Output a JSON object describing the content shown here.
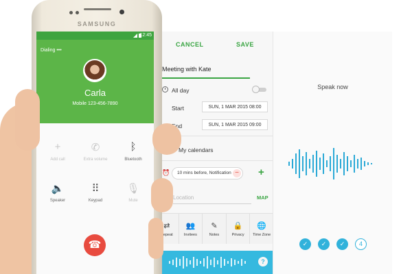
{
  "phone": {
    "brand": "SAMSUNG",
    "status_time": "12:45",
    "call": {
      "status": "Dialing",
      "contact_name": "Carla",
      "contact_number": "Mobile  123-456-7890"
    },
    "actions": [
      {
        "label": "Add call",
        "icon": "add-call-icon",
        "enabled": false
      },
      {
        "label": "Extra volume",
        "icon": "extra-volume-icon",
        "enabled": false
      },
      {
        "label": "Bluetooth",
        "icon": "bluetooth-icon",
        "enabled": true
      },
      {
        "label": "Speaker",
        "icon": "speaker-icon",
        "enabled": true
      },
      {
        "label": "Keypad",
        "icon": "keypad-icon",
        "enabled": true
      },
      {
        "label": "Mute",
        "icon": "mute-icon",
        "enabled": false
      }
    ],
    "end_call_icon": "end-call-icon"
  },
  "calendar": {
    "cancel": "CANCEL",
    "save": "SAVE",
    "title": "Meeting with Kate",
    "all_day": "All day",
    "start_label": "Start",
    "start_value": "SUN, 1 MAR 2015   08:00",
    "end_label": "End",
    "end_value": "SUN, 1 MAR 2015   09:00",
    "calendars": "My calendars",
    "reminder": "10 mins before, Notification",
    "location_placeholder": "Location",
    "map": "MAP",
    "tools": [
      {
        "label": "Repeat",
        "icon": "repeat-icon"
      },
      {
        "label": "Invitees",
        "icon": "invitees-icon"
      },
      {
        "label": "Notes",
        "icon": "notes-icon"
      },
      {
        "label": "Privacy",
        "icon": "privacy-icon"
      },
      {
        "label": "Time Zone",
        "icon": "time-zone-icon"
      }
    ]
  },
  "voice": {
    "prompt": "Speak now",
    "step_final": "4"
  },
  "colors": {
    "green": "#3aa543",
    "call_header": "#5cb548",
    "end_call": "#e84b3f",
    "voice_blue": "#35b9df"
  }
}
